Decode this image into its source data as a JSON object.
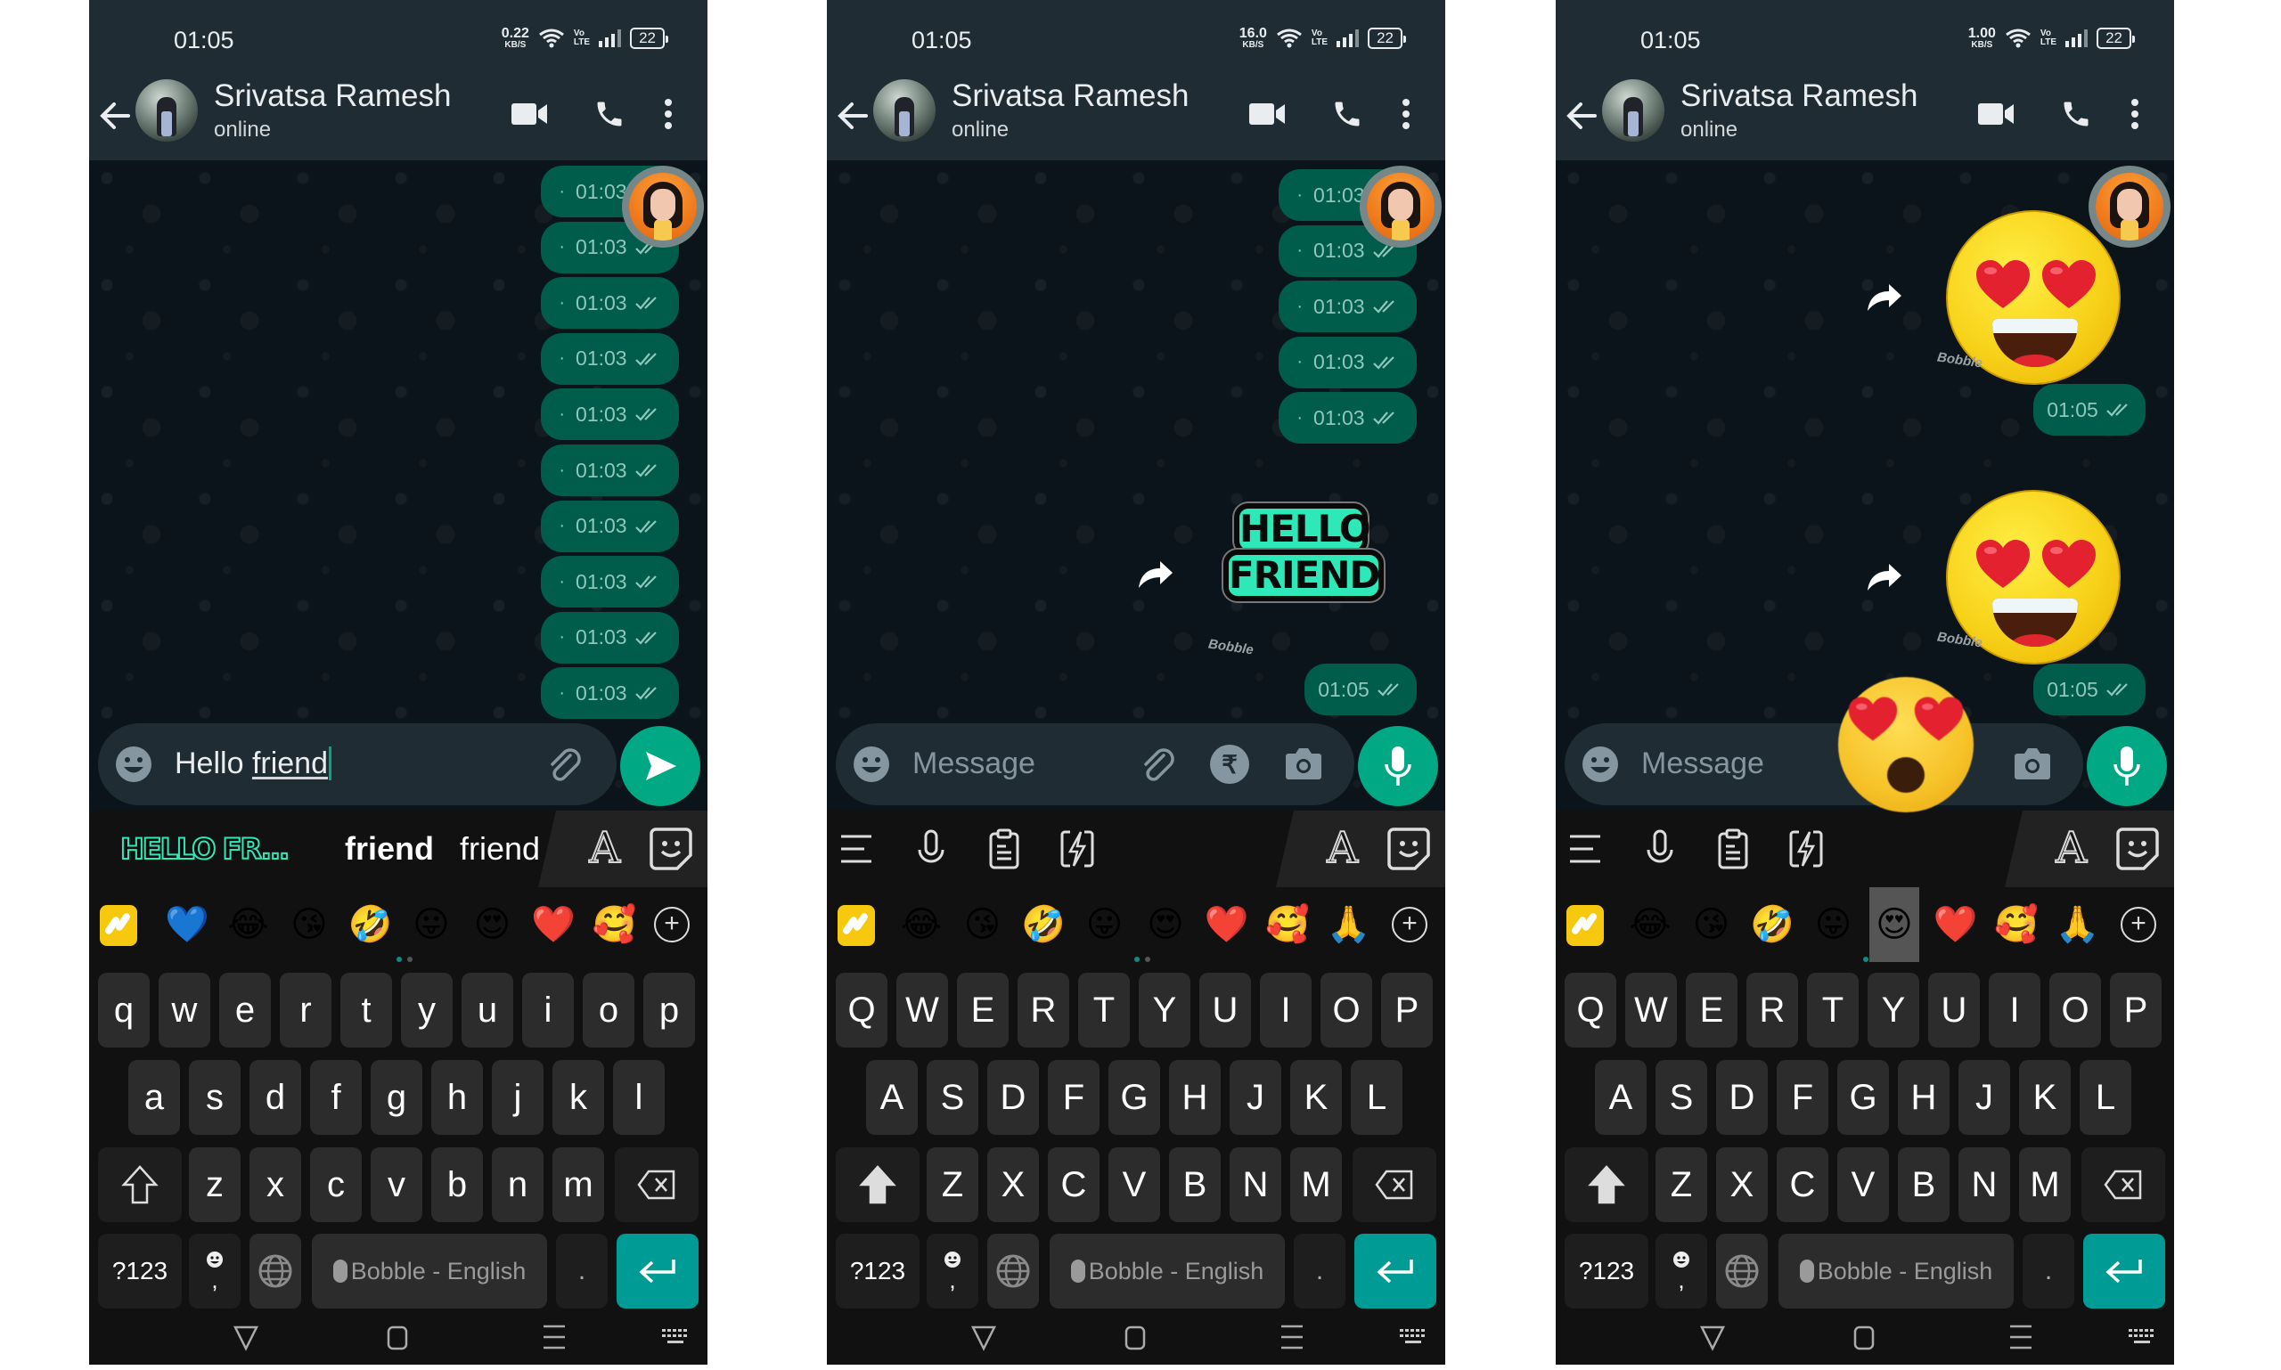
{
  "panels": [
    {
      "status": {
        "time": "01:05",
        "net_speed": "0.22",
        "net_unit": "KB/S",
        "volte_top": "Vo",
        "volte_bottom": "LTE",
        "battery": "22"
      },
      "header": {
        "name": "Srivatsa Ramesh",
        "status": "online"
      },
      "messages": [
        "01:03",
        "01:03",
        "01:03",
        "01:03",
        "01:03",
        "01:03",
        "01:03",
        "01:03",
        "01:03",
        "01:03"
      ],
      "input": {
        "text_plain": "Hello ",
        "text_underlined": "friend"
      },
      "suggestions": {
        "sticker": "HELLO FR...",
        "word1": "friend",
        "word2": "friend"
      },
      "emoji_row": [
        "💙",
        "😂",
        "😘",
        "🤣",
        "😛",
        "😍",
        "❤️",
        "🥰"
      ]
    },
    {
      "status": {
        "time": "01:05",
        "net_speed": "16.0",
        "net_unit": "KB/S",
        "volte_top": "Vo",
        "volte_bottom": "LTE",
        "battery": "22"
      },
      "header": {
        "name": "Srivatsa Ramesh",
        "status": "online"
      },
      "messages": [
        "01:03",
        "01:03",
        "01:03",
        "01:03",
        "01:03"
      ],
      "sticker": {
        "line1": "HELLO",
        "line2": "FRIEND",
        "time": "01:05",
        "watermark": "Bobble"
      },
      "input": {
        "placeholder": "Message",
        "rupee": "₹"
      },
      "emoji_row": [
        "😂",
        "😘",
        "🤣",
        "😛",
        "😍",
        "❤️",
        "🥰",
        "🙏"
      ]
    },
    {
      "status": {
        "time": "01:05",
        "net_speed": "1.00",
        "net_unit": "KB/S",
        "volte_top": "Vo",
        "volte_bottom": "LTE",
        "battery": "22"
      },
      "header": {
        "name": "Srivatsa Ramesh",
        "status": "online"
      },
      "stickers": [
        {
          "type": "heart-eyes-emoji",
          "time": "01:05",
          "watermark": "Bobble"
        },
        {
          "type": "heart-eyes-emoji",
          "time": "01:05",
          "watermark": "Bobble"
        }
      ],
      "input": {
        "placeholder": "Message"
      },
      "emoji_row": [
        "😂",
        "😘",
        "🤣",
        "😛",
        "😍",
        "❤️",
        "🥰",
        "🙏"
      ],
      "selected_emoji": "😍"
    }
  ],
  "keyboard": {
    "lower": {
      "row1": [
        "q",
        "w",
        "e",
        "r",
        "t",
        "y",
        "u",
        "i",
        "o",
        "p"
      ],
      "row2": [
        "a",
        "s",
        "d",
        "f",
        "g",
        "h",
        "j",
        "k",
        "l"
      ],
      "row3": [
        "z",
        "x",
        "c",
        "v",
        "b",
        "n",
        "m"
      ]
    },
    "upper": {
      "row1": [
        "Q",
        "W",
        "E",
        "R",
        "T",
        "Y",
        "U",
        "I",
        "O",
        "P"
      ],
      "row2": [
        "A",
        "S",
        "D",
        "F",
        "G",
        "H",
        "J",
        "K",
        "L"
      ],
      "row3": [
        "Z",
        "X",
        "C",
        "V",
        "B",
        "N",
        "M"
      ]
    },
    "symbols_label": "?123",
    "comma": ",",
    "space_label": "Bobble - English",
    "period": ".",
    "plus": "+"
  },
  "colors": {
    "header_bg": "#1f2c34",
    "chat_bg": "#0b141a",
    "bubble_out": "#005c4b",
    "accent": "#00a884",
    "enter_key": "#009b95",
    "sticker_green": "#2ee8b7"
  }
}
